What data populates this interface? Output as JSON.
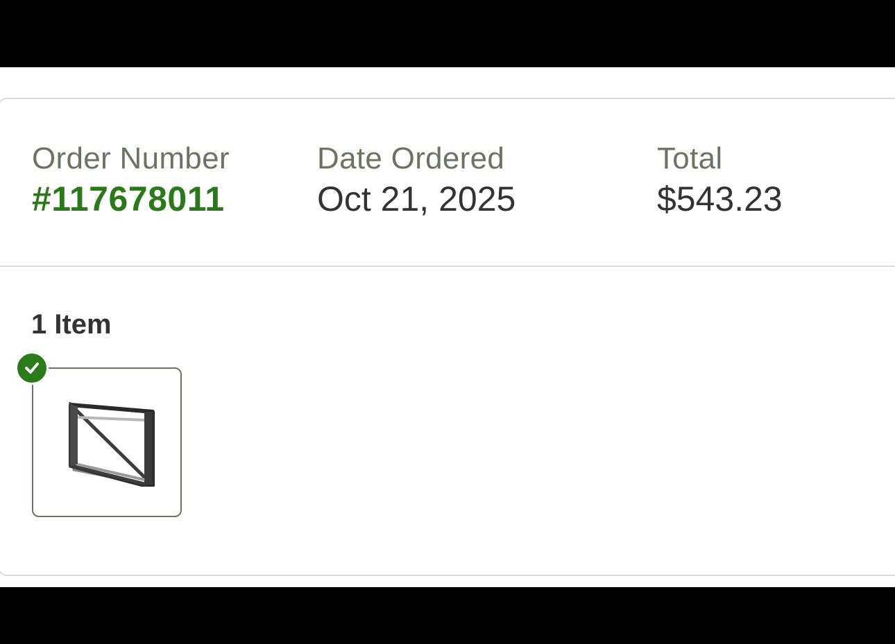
{
  "order": {
    "order_number_label": "Order Number",
    "order_number_value": "#117678011",
    "date_label": "Date Ordered",
    "date_value": "Oct 21, 2025",
    "total_label": "Total",
    "total_value": "$543.23"
  },
  "items": {
    "count_label": "1 Item",
    "list": [
      {
        "icon": "check-circle-icon",
        "status_color": "#2a7a1a"
      }
    ]
  },
  "colors": {
    "accent_green": "#2a7a1a",
    "label_gray": "#6b7463",
    "text_dark": "#333333",
    "border": "#dcdcda"
  }
}
